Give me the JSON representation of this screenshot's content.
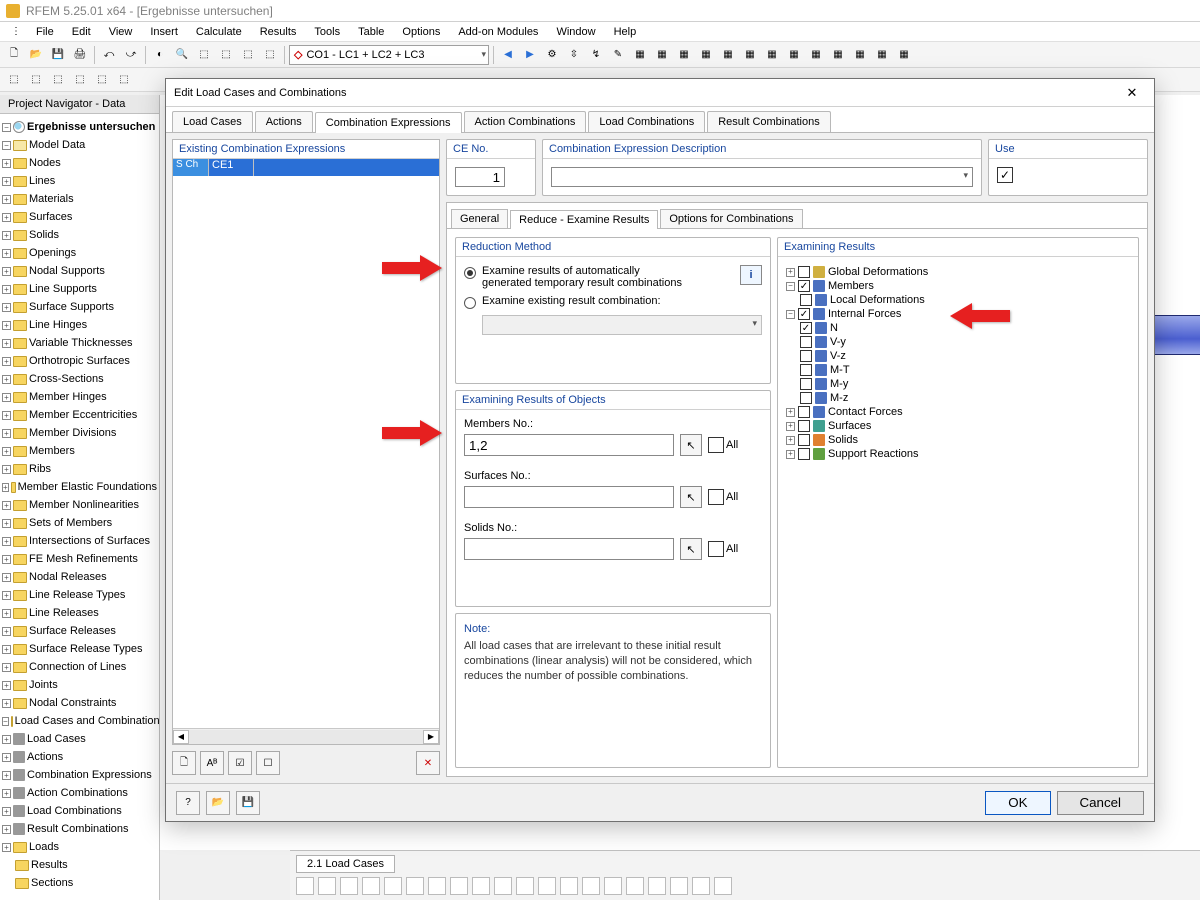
{
  "titlebar": {
    "text": "RFEM 5.25.01 x64 - [Ergebnisse untersuchen]"
  },
  "menu": [
    "File",
    "Edit",
    "View",
    "Insert",
    "Calculate",
    "Results",
    "Tools",
    "Table",
    "Options",
    "Add-on Modules",
    "Window",
    "Help"
  ],
  "toolbar": {
    "combo_label": "CO1 - LC1 + LC2 + LC3"
  },
  "navigator": {
    "panel_title": "Project Navigator - Data",
    "root": "Ergebnisse untersuchen",
    "model_data": "Model Data",
    "items_model": [
      "Nodes",
      "Lines",
      "Materials",
      "Surfaces",
      "Solids",
      "Openings",
      "Nodal Supports",
      "Line Supports",
      "Surface Supports",
      "Line Hinges",
      "Variable Thicknesses",
      "Orthotropic Surfaces",
      "Cross-Sections",
      "Member Hinges",
      "Member Eccentricities",
      "Member Divisions",
      "Members",
      "Ribs",
      "Member Elastic Foundations",
      "Member Nonlinearities",
      "Sets of Members",
      "Intersections of Surfaces",
      "FE Mesh Refinements",
      "Nodal Releases",
      "Line Release Types",
      "Line Releases",
      "Surface Releases",
      "Surface Release Types",
      "Connection of Lines",
      "Joints",
      "Nodal Constraints"
    ],
    "loads_cc": "Load Cases and Combinations",
    "items_cc": [
      "Load Cases",
      "Actions",
      "Combination Expressions",
      "Action Combinations",
      "Load Combinations",
      "Result Combinations"
    ],
    "loads": "Loads",
    "results": "Results",
    "sections": "Sections"
  },
  "dialog": {
    "title": "Edit Load Cases and Combinations",
    "tabs": [
      "Load Cases",
      "Actions",
      "Combination Expressions",
      "Action Combinations",
      "Load Combinations",
      "Result Combinations"
    ],
    "active_tab": "Combination Expressions",
    "list_header": "Existing Combination Expressions",
    "list_row": {
      "tag": "S Ch",
      "id": "CE1",
      "desc": ""
    },
    "ceNo": {
      "title": "CE No.",
      "value": "1"
    },
    "ceDesc": {
      "title": "Combination Expression Description",
      "value": ""
    },
    "use": {
      "title": "Use",
      "checked": true
    },
    "inner_tabs": [
      "General",
      "Reduce - Examine Results",
      "Options for Combinations"
    ],
    "inner_active": "Reduce - Examine Results",
    "reduction": {
      "title": "Reduction Method",
      "opt1": "Examine results of automatically generated temporary result combinations",
      "opt2": "Examine existing result combination:",
      "selected": 0
    },
    "objects": {
      "title": "Examining Results of Objects",
      "members_label": "Members No.:",
      "members_value": "1,2",
      "surfaces_label": "Surfaces No.:",
      "surfaces_value": "",
      "solids_label": "Solids No.:",
      "solids_value": "",
      "all": "All"
    },
    "note": {
      "title": "Note:",
      "text": "All load cases that are irrelevant to these initial result combinations (linear analysis) will not be considered, which reduces the number of possible combinations."
    },
    "extree": {
      "title": "Examining Results",
      "global_def": "Global Deformations",
      "members": "Members",
      "local_def": "Local Deformations",
      "internal_forces": "Internal Forces",
      "if_items": [
        "N",
        "V-y",
        "V-z",
        "M-T",
        "M-y",
        "M-z"
      ],
      "contact_forces": "Contact Forces",
      "surfaces": "Surfaces",
      "solids": "Solids",
      "support_reactions": "Support Reactions"
    },
    "buttons": {
      "ok": "OK",
      "cancel": "Cancel"
    }
  },
  "table": {
    "tab": "2.1 Load Cases"
  }
}
